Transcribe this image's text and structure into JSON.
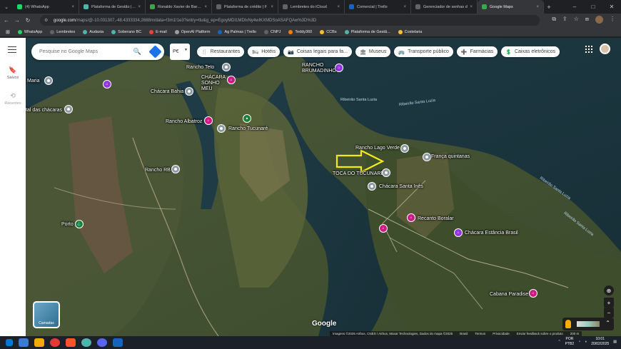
{
  "tabs": [
    {
      "title": "(4) WhatsApp",
      "color": "#25d366"
    },
    {
      "title": "Plataforma de Gestão | Lu",
      "color": "#4db6ac"
    },
    {
      "title": "Ronaldo Xavier de Barros",
      "color": "#43a047"
    },
    {
      "title": "Plataforma de crédito | F",
      "color": "#5f6368"
    },
    {
      "title": "Lembretes do iCloud",
      "color": "#5f6368"
    },
    {
      "title": "Comercial | Trello",
      "color": "#1565c0"
    },
    {
      "title": "Gerenciador de senhas d",
      "color": "#5f6368"
    },
    {
      "title": "Google Maps",
      "color": "#34a853",
      "active": true
    }
  ],
  "tab_close": "×",
  "new_tab": "+",
  "window_controls": [
    "–",
    "□",
    "✕"
  ],
  "url_host": "google.com",
  "url_path": "/maps/@-10.031307,-48.4333334,2688m/data=!3m1!1e3?entry=ttu&g_ep=EgoyMDI1MDIxNy4wIKXMDSoASAFQAw%3D%3D",
  "bookmarks": [
    {
      "label": "WhatsApp",
      "color": "#25d366"
    },
    {
      "label": "Lembretes",
      "color": "#5f6368"
    },
    {
      "label": "Audaxia",
      "color": "#4db6ac"
    },
    {
      "label": "Soberano BC",
      "color": "#4db6ac"
    },
    {
      "label": "E-mail",
      "color": "#ea4335"
    },
    {
      "label": "OpenAI Platform",
      "color": "#9e9e9e"
    },
    {
      "label": "Ag Palmas | Trello",
      "color": "#1565c0"
    },
    {
      "label": "CNPJ",
      "color": "#5f6368"
    },
    {
      "label": "Teddy360",
      "color": "#f57c00"
    },
    {
      "label": "CCBs",
      "color": "#fbc02d"
    },
    {
      "label": "Plataforma de Gestã...",
      "color": "#4db6ac"
    },
    {
      "label": "Costelaria",
      "color": "#fbc02d"
    }
  ],
  "sidebar": {
    "saved": "Salvos",
    "recent": "Recentes"
  },
  "search": {
    "placeholder": "Pesquise no Google Maps"
  },
  "partial_box": "P€",
  "chips": [
    {
      "label": "Restaurantes",
      "icon": "🍴"
    },
    {
      "label": "Hotéis",
      "icon": "🛏"
    },
    {
      "label": "Coisas legais para fa...",
      "icon": "📷"
    },
    {
      "label": "Museus",
      "icon": "🏛"
    },
    {
      "label": "Transporte público",
      "icon": "🚌"
    },
    {
      "label": "Farmácias",
      "icon": "➕"
    },
    {
      "label": "Caixas eletrônicos",
      "icon": "💲"
    }
  ],
  "places": [
    {
      "label": "Rancho Teto"
    },
    {
      "label": "RANCHO BRUMADINHO"
    },
    {
      "label": "CHÁCARA SONHO MEU"
    },
    {
      "label": "Maria"
    },
    {
      "label": "Chácara Bahia"
    },
    {
      "label": "tal das chácaras"
    },
    {
      "label": "Rancho Albatroz"
    },
    {
      "label": "Rancho Tucunaré"
    },
    {
      "label": "Rancho Lago Verde"
    },
    {
      "label": "França quintanas"
    },
    {
      "label": "TOCA DO TUCUNARÉ..."
    },
    {
      "label": "Chácara Santa Inês"
    },
    {
      "label": "Rancho RB"
    },
    {
      "label": "Recanto Boralar"
    },
    {
      "label": "Chácara Estância Brasil"
    },
    {
      "label": "Porto"
    },
    {
      "label": "Cabana Paradise"
    }
  ],
  "water_labels": [
    "Ribeirão Santa Luzia",
    "Ribeirão Santa Luzia",
    "Ribeirão Santa Luzia",
    "Ribeirão Santa Luzia"
  ],
  "layers_label": "Camadas",
  "google_logo": "Google",
  "attribution": [
    "Imagens ©2025 Airbus, CNES / Airbus, Maxar Technologies, Dados do mapa ©2025",
    "Brasil",
    "Termos",
    "Privacidade",
    "Enviar feedback sobre o produto",
    "200 m"
  ],
  "tray": {
    "lang": "POR",
    "layout": "PTB2",
    "time": "10:01",
    "date": "20/02/2025"
  }
}
